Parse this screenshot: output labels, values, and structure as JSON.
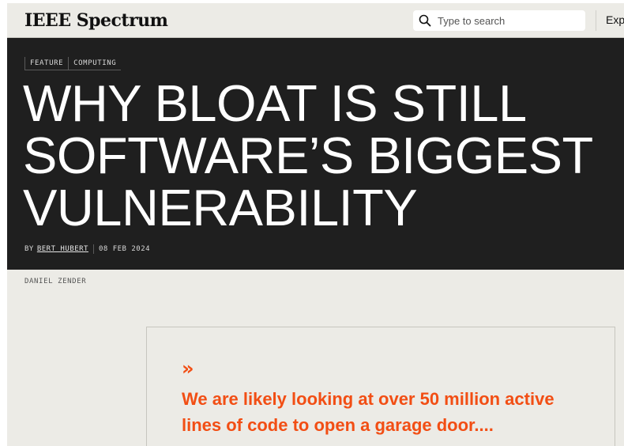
{
  "header": {
    "logo": "IEEE Spectrum",
    "search_placeholder": "Type to search",
    "explore_label": "Exp"
  },
  "article": {
    "tags": [
      "FEATURE",
      "COMPUTING"
    ],
    "headline": "WHY BLOAT IS STILL SOFTWARE’S BIGGEST VULNERABILITY",
    "byline_prefix": "BY",
    "author": "BERT HUBERT",
    "date": "08 FEB 2024",
    "image_credit": "DANIEL ZENDER"
  },
  "pull_quote": {
    "icon": "»",
    "text": "We are likely looking at over 50 million active lines of code to open a garage door...."
  },
  "colors": {
    "hero_bg": "#1f1f1f",
    "page_bg": "#ecebe6",
    "accent": "#f24e14"
  },
  "icons": [
    "search-icon",
    "double-chevron-right-icon"
  ]
}
